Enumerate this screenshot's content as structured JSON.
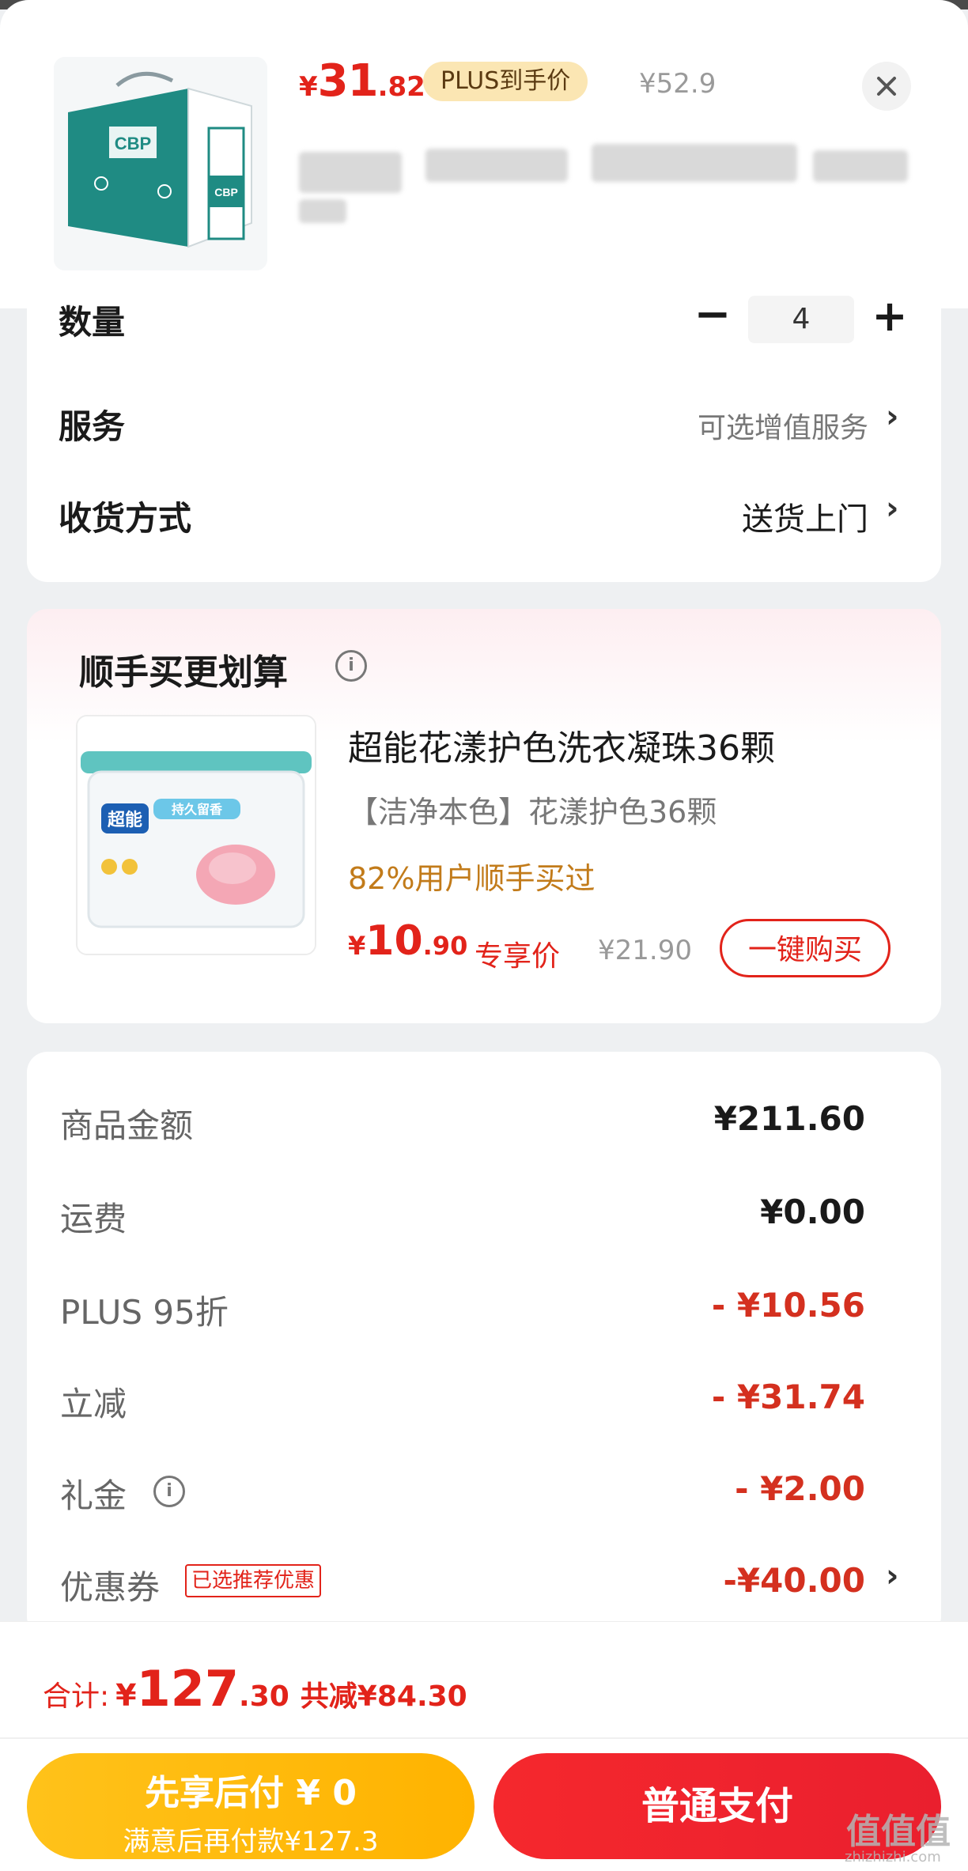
{
  "product": {
    "price_symbol": "¥",
    "price_int": "31",
    "price_dec": ".82",
    "plus_badge": "PLUS到手价",
    "original_price": "¥52.9",
    "close_icon": "close-icon",
    "image_text_1": "CBP",
    "image_text_2": "CBP"
  },
  "quantity": {
    "label": "数量",
    "minus": "−",
    "value": "4",
    "plus": "+"
  },
  "service": {
    "label": "服务",
    "value": "可选增值服务"
  },
  "delivery": {
    "label": "收货方式",
    "value": "送货上门"
  },
  "chevron": "›",
  "upsell": {
    "title": "顺手买更划算",
    "info_icon": "i",
    "name": "超能花漾护色洗衣凝珠36颗",
    "spec": "【洁净本色】花漾护色36颗",
    "percent_text": "82%用户顺手买过",
    "price_symbol": "¥",
    "price_int": "10",
    "price_dec": ".90",
    "price_tag": "专享价",
    "original_price": "¥21.90",
    "buy_button": "一键购买",
    "image_brand": "超能",
    "image_sub": "持久留香"
  },
  "summary": {
    "rows": [
      {
        "label": "商品金额",
        "value": "¥211.60",
        "red": false
      },
      {
        "label": "运费",
        "value": "¥0.00",
        "red": false
      },
      {
        "label": "PLUS 95折",
        "value": "- ¥10.56",
        "red": true
      },
      {
        "label": "立减",
        "value": "- ¥31.74",
        "red": true
      },
      {
        "label": "礼金",
        "value": "- ¥2.00",
        "red": true
      },
      {
        "label": "优惠券",
        "value": "-¥40.00",
        "red": true
      }
    ],
    "coupon_tag": "已选推荐优惠"
  },
  "footer": {
    "total_label": "合计:",
    "total_symbol": "¥",
    "total_int": "127",
    "total_dec": ".30",
    "total_saving": "共减¥84.30",
    "pay_later_line1": "先享后付 ¥ 0",
    "pay_later_line2": "满意后再付款¥127.3",
    "pay_button": "普通支付"
  },
  "watermark": {
    "text": "值值值",
    "domain": "zhizhizhi.com"
  }
}
